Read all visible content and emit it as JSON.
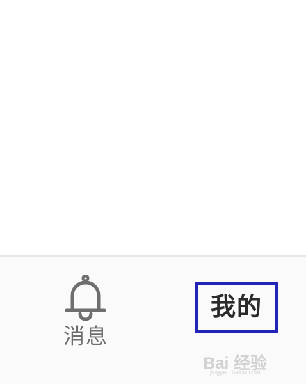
{
  "tab_bar": {
    "items": [
      {
        "label": "消息",
        "icon": "bell-icon"
      },
      {
        "label": "我的",
        "highlighted": true
      }
    ]
  },
  "watermark": {
    "brand": "Bai 经验",
    "url": "jingyan.baidu.com"
  },
  "colors": {
    "highlight_border": "#2323b8",
    "icon_gray": "#6e6e6e",
    "tab_bar_bg": "#fafafa"
  }
}
